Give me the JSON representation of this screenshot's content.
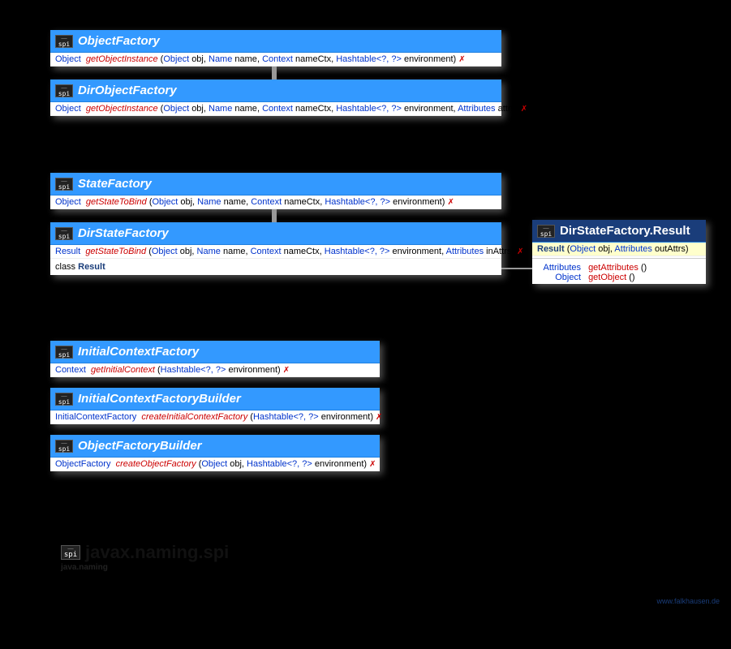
{
  "classes": {
    "objectFactory": {
      "name": "ObjectFactory",
      "sig": {
        "ret": "Object",
        "method": "getObjectInstance",
        "params": [
          {
            "t": "Object",
            "n": "obj"
          },
          {
            "t": "Name",
            "n": "name"
          },
          {
            "t": "Context",
            "n": "nameCtx"
          },
          {
            "t": "Hashtable<?, ?>",
            "n": "environment"
          }
        ]
      }
    },
    "dirObjectFactory": {
      "name": "DirObjectFactory",
      "sig": {
        "ret": "Object",
        "method": "getObjectInstance",
        "params": [
          {
            "t": "Object",
            "n": "obj"
          },
          {
            "t": "Name",
            "n": "name"
          },
          {
            "t": "Context",
            "n": "nameCtx"
          },
          {
            "t": "Hashtable<?, ?>",
            "n": "environment"
          },
          {
            "t": "Attributes",
            "n": "attrs"
          }
        ]
      }
    },
    "stateFactory": {
      "name": "StateFactory",
      "sig": {
        "ret": "Object",
        "method": "getStateToBind",
        "params": [
          {
            "t": "Object",
            "n": "obj"
          },
          {
            "t": "Name",
            "n": "name"
          },
          {
            "t": "Context",
            "n": "nameCtx"
          },
          {
            "t": "Hashtable<?, ?>",
            "n": "environment"
          }
        ]
      }
    },
    "dirStateFactory": {
      "name": "DirStateFactory",
      "sig": {
        "ret": "Result",
        "method": "getStateToBind",
        "params": [
          {
            "t": "Object",
            "n": "obj"
          },
          {
            "t": "Name",
            "n": "name"
          },
          {
            "t": "Context",
            "n": "nameCtx"
          },
          {
            "t": "Hashtable<?, ?>",
            "n": "environment"
          },
          {
            "t": "Attributes",
            "n": "inAttrs"
          }
        ]
      },
      "nested": {
        "kw": "class",
        "name": "Result"
      }
    },
    "dirStateFactoryResult": {
      "name": "DirStateFactory.Result",
      "ctor": {
        "ret": "Result",
        "params": [
          {
            "t": "Object",
            "n": "obj"
          },
          {
            "t": "Attributes",
            "n": "outAttrs"
          }
        ]
      },
      "methods": [
        {
          "ret": "Attributes",
          "name": "getAttributes"
        },
        {
          "ret": "Object",
          "name": "getObject"
        }
      ]
    },
    "initialContextFactory": {
      "name": "InitialContextFactory",
      "sig": {
        "ret": "Context",
        "method": "getInitialContext",
        "params": [
          {
            "t": "Hashtable<?, ?>",
            "n": "environment"
          }
        ]
      }
    },
    "initialContextFactoryBuilder": {
      "name": "InitialContextFactoryBuilder",
      "sig": {
        "ret": "InitialContextFactory",
        "method": "createInitialContextFactory",
        "params": [
          {
            "t": "Hashtable<?, ?>",
            "n": "environment"
          }
        ]
      }
    },
    "objectFactoryBuilder": {
      "name": "ObjectFactoryBuilder",
      "sig": {
        "ret": "ObjectFactory",
        "method": "createObjectFactory",
        "params": [
          {
            "t": "Object",
            "n": "obj"
          },
          {
            "t": "Hashtable<?, ?>",
            "n": "environment"
          }
        ]
      }
    }
  },
  "package": {
    "name": "javax.naming.spi",
    "module": "java.naming"
  },
  "watermark": "www.falkhausen.de",
  "throwsGlyph": "✗",
  "spiLabel": "spi"
}
